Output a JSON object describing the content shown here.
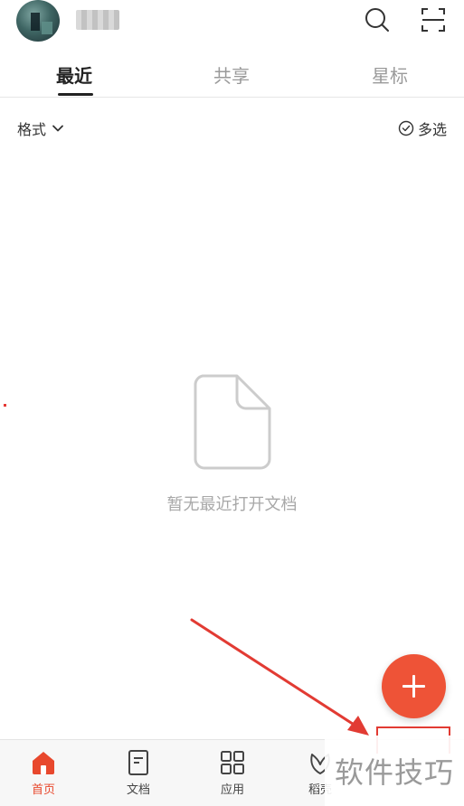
{
  "header": {
    "avatar_icon": "user-avatar",
    "search_icon": "search-icon",
    "scan_icon": "scan-icon"
  },
  "tabs": [
    {
      "label": "最近",
      "active": true
    },
    {
      "label": "共享",
      "active": false
    },
    {
      "label": "星标",
      "active": false
    }
  ],
  "filters": {
    "format_label": "格式",
    "multi_select_label": "多选"
  },
  "empty_state": {
    "icon": "document-icon",
    "text": "暂无最近打开文档"
  },
  "fab": {
    "icon": "plus-icon",
    "color": "#ee5337"
  },
  "bottom_nav": [
    {
      "label": "首页",
      "icon": "home-icon",
      "active": true
    },
    {
      "label": "文档",
      "icon": "document-icon",
      "active": false
    },
    {
      "label": "应用",
      "icon": "apps-grid-icon",
      "active": false
    },
    {
      "label": "稻壳",
      "icon": "daoke-icon",
      "active": false
    }
  ],
  "watermark": {
    "text": "软件技巧"
  },
  "colors": {
    "accent": "#e8482d",
    "annotation": "#e23b33"
  }
}
